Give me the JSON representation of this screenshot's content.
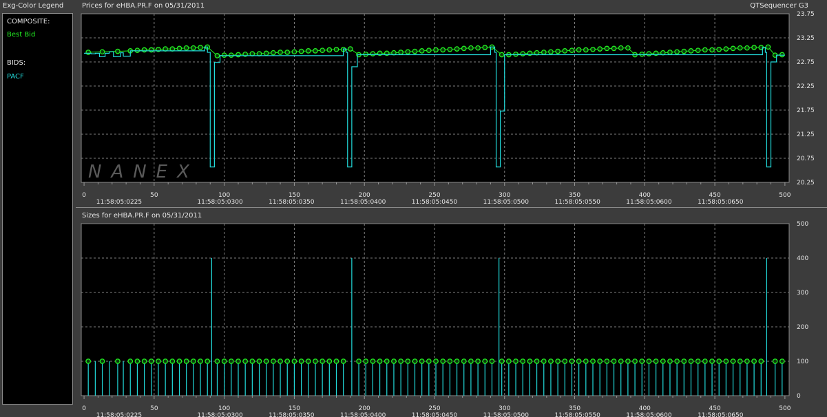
{
  "legend": {
    "title": "Exg-Color Legend",
    "composite_label": "COMPOSITE:",
    "composite_item": "Best Bid",
    "bids_label": "BIDS:",
    "bids_item": "PACF"
  },
  "app_title": "QTSequencer G3",
  "watermark": "NANEX",
  "colors": {
    "best_bid": "#22ee22",
    "pacf": "#22dddd",
    "grid": "#808080",
    "plot_bg": "#000000",
    "frame": "#8a8a8a"
  },
  "chart_data": [
    {
      "type": "line",
      "title": "Prices for  eHBA.PR.F  on  05/31/2011",
      "x_ticks": [
        "0",
        "50",
        "100",
        "150",
        "200",
        "250",
        "300",
        "350",
        "400",
        "450",
        "500"
      ],
      "x_tick_values": [
        0,
        50,
        100,
        150,
        200,
        250,
        300,
        350,
        400,
        450,
        500
      ],
      "time_labels": [
        "11:58:05:0225",
        "11:58:05:0300",
        "11:58:05:0350",
        "11:58:05:0400",
        "11:58:05:0450",
        "11:58:05:0500",
        "11:58:05:0550",
        "11:58:05:0600",
        "11:58:05:0650"
      ],
      "time_label_x": [
        25,
        97,
        148,
        199,
        250,
        301,
        352,
        403,
        454
      ],
      "y_ticks": [
        "23.75",
        "23.25",
        "22.75",
        "22.25",
        "21.75",
        "21.25",
        "20.75",
        "20.25"
      ],
      "ylim": [
        20.25,
        23.75
      ],
      "xlim": [
        -2,
        503
      ],
      "grid": true,
      "series": [
        {
          "name": "Best Bid",
          "color": "#22ee22",
          "style": "marker-line",
          "x": [
            3,
            13,
            24,
            33,
            38,
            43,
            48,
            53,
            58,
            63,
            68,
            73,
            78,
            83,
            88,
            95,
            100,
            105,
            110,
            115,
            120,
            125,
            130,
            135,
            140,
            145,
            150,
            155,
            160,
            165,
            170,
            175,
            180,
            185,
            190,
            196,
            201,
            206,
            211,
            216,
            221,
            226,
            231,
            236,
            241,
            246,
            251,
            256,
            261,
            266,
            271,
            276,
            281,
            286,
            291,
            298,
            303,
            308,
            313,
            318,
            323,
            328,
            333,
            338,
            343,
            348,
            353,
            358,
            363,
            368,
            373,
            378,
            383,
            388,
            393,
            398,
            403,
            408,
            413,
            418,
            423,
            428,
            433,
            438,
            443,
            448,
            453,
            458,
            463,
            468,
            473,
            478,
            483,
            488,
            493,
            498
          ],
          "y": [
            22.95,
            22.96,
            22.97,
            22.98,
            22.99,
            23.0,
            23.0,
            23.01,
            23.02,
            23.02,
            23.03,
            23.04,
            23.04,
            23.05,
            23.06,
            22.88,
            22.89,
            22.89,
            22.9,
            22.91,
            22.92,
            22.92,
            22.93,
            22.94,
            22.95,
            22.95,
            22.96,
            22.97,
            22.98,
            22.98,
            22.99,
            23.0,
            23.01,
            23.01,
            23.02,
            22.9,
            22.91,
            22.92,
            22.93,
            22.93,
            22.94,
            22.95,
            22.96,
            22.97,
            22.98,
            22.99,
            23.0,
            23.0,
            23.01,
            23.02,
            23.03,
            23.04,
            23.04,
            23.05,
            23.06,
            22.9,
            22.9,
            22.91,
            22.92,
            22.93,
            22.94,
            22.95,
            22.96,
            22.97,
            22.98,
            22.99,
            23.0,
            23.0,
            23.01,
            23.02,
            23.03,
            23.03,
            23.04,
            23.04,
            22.9,
            22.91,
            22.92,
            22.93,
            22.94,
            22.95,
            22.96,
            22.97,
            22.98,
            22.99,
            23.0,
            23.0,
            23.01,
            23.02,
            23.03,
            23.04,
            23.04,
            23.05,
            23.05,
            23.06,
            22.89,
            22.9
          ]
        },
        {
          "name": "PACF",
          "color": "#22dddd",
          "style": "step",
          "x": [
            0,
            5,
            8,
            11,
            15,
            18,
            21,
            26,
            28,
            31,
            33,
            86,
            88,
            90,
            92,
            93,
            95,
            97,
            185,
            187,
            188,
            190,
            191,
            193,
            195,
            290,
            293,
            294,
            296,
            297,
            299,
            300,
            484,
            486,
            487,
            489,
            490,
            492,
            494,
            500
          ],
          "y": [
            22.93,
            22.92,
            22.93,
            22.86,
            22.93,
            22.96,
            22.86,
            22.94,
            22.87,
            22.87,
            22.98,
            23.06,
            22.95,
            20.57,
            20.57,
            22.74,
            22.74,
            22.88,
            23.02,
            22.95,
            20.57,
            20.57,
            22.65,
            22.65,
            22.9,
            23.06,
            22.95,
            20.57,
            20.57,
            21.73,
            21.73,
            22.9,
            23.05,
            22.95,
            20.57,
            20.57,
            22.75,
            22.75,
            22.89,
            22.89
          ]
        }
      ]
    },
    {
      "type": "bar",
      "title": "Sizes for  eHBA.PR.F  on  05/31/2011",
      "x_ticks": [
        "0",
        "50",
        "100",
        "150",
        "200",
        "250",
        "300",
        "350",
        "400",
        "450",
        "500"
      ],
      "x_tick_values": [
        0,
        50,
        100,
        150,
        200,
        250,
        300,
        350,
        400,
        450,
        500
      ],
      "time_labels": [
        "11:58:05:0225",
        "11:58:05:0300",
        "11:58:05:0350",
        "11:58:05:0400",
        "11:58:05:0450",
        "11:58:05:0500",
        "11:58:05:0550",
        "11:58:05:0600",
        "11:58:05:0650"
      ],
      "time_label_x": [
        25,
        97,
        148,
        199,
        250,
        301,
        352,
        403,
        454
      ],
      "y_ticks": [
        "500",
        "400",
        "300",
        "200",
        "100",
        "0"
      ],
      "ylim": [
        0,
        500
      ],
      "xlim": [
        -2,
        503
      ],
      "grid": true,
      "series": [
        {
          "name": "PACF",
          "color": "#22dddd",
          "style": "spikes",
          "x": [
            3,
            8,
            13,
            18,
            24,
            28,
            33,
            38,
            43,
            48,
            53,
            58,
            63,
            68,
            73,
            78,
            83,
            88,
            91,
            95,
            100,
            105,
            110,
            115,
            120,
            125,
            130,
            135,
            140,
            145,
            150,
            155,
            160,
            165,
            170,
            175,
            180,
            185,
            191,
            196,
            201,
            206,
            211,
            216,
            221,
            226,
            231,
            236,
            241,
            246,
            251,
            256,
            261,
            266,
            271,
            276,
            281,
            286,
            291,
            296,
            298,
            303,
            308,
            313,
            318,
            323,
            328,
            333,
            338,
            343,
            348,
            353,
            358,
            363,
            368,
            373,
            378,
            383,
            388,
            393,
            398,
            403,
            408,
            413,
            418,
            423,
            428,
            433,
            438,
            443,
            448,
            453,
            458,
            463,
            468,
            473,
            478,
            483,
            487,
            493,
            498
          ],
          "y": [
            100,
            100,
            100,
            100,
            100,
            100,
            100,
            100,
            100,
            100,
            100,
            100,
            100,
            100,
            100,
            100,
            100,
            100,
            400,
            100,
            100,
            100,
            100,
            100,
            100,
            100,
            100,
            100,
            100,
            100,
            100,
            100,
            100,
            100,
            100,
            100,
            100,
            100,
            400,
            100,
            100,
            100,
            100,
            100,
            100,
            100,
            100,
            100,
            100,
            100,
            100,
            100,
            100,
            100,
            100,
            100,
            100,
            100,
            100,
            400,
            100,
            100,
            100,
            100,
            100,
            100,
            100,
            100,
            100,
            100,
            100,
            100,
            100,
            100,
            100,
            100,
            100,
            100,
            100,
            100,
            100,
            100,
            100,
            100,
            100,
            100,
            100,
            100,
            100,
            100,
            100,
            100,
            100,
            100,
            100,
            100,
            100,
            100,
            400,
            100,
            100
          ]
        },
        {
          "name": "Best Bid",
          "color": "#22ee22",
          "style": "markers",
          "x": [
            3,
            13,
            24,
            33,
            38,
            43,
            48,
            53,
            58,
            63,
            68,
            73,
            78,
            83,
            88,
            95,
            100,
            105,
            110,
            115,
            120,
            125,
            130,
            135,
            140,
            145,
            150,
            155,
            160,
            165,
            170,
            175,
            180,
            185,
            196,
            201,
            206,
            211,
            216,
            221,
            226,
            231,
            236,
            241,
            246,
            251,
            256,
            261,
            266,
            271,
            276,
            281,
            286,
            291,
            298,
            303,
            308,
            313,
            318,
            323,
            328,
            333,
            338,
            343,
            348,
            353,
            358,
            363,
            368,
            373,
            378,
            383,
            388,
            393,
            398,
            403,
            408,
            413,
            418,
            423,
            428,
            433,
            438,
            443,
            448,
            453,
            458,
            463,
            468,
            473,
            478,
            483,
            493,
            498
          ],
          "y": [
            100,
            100,
            100,
            100,
            100,
            100,
            100,
            100,
            100,
            100,
            100,
            100,
            100,
            100,
            100,
            100,
            100,
            100,
            100,
            100,
            100,
            100,
            100,
            100,
            100,
            100,
            100,
            100,
            100,
            100,
            100,
            100,
            100,
            100,
            100,
            100,
            100,
            100,
            100,
            100,
            100,
            100,
            100,
            100,
            100,
            100,
            100,
            100,
            100,
            100,
            100,
            100,
            100,
            100,
            100,
            100,
            100,
            100,
            100,
            100,
            100,
            100,
            100,
            100,
            100,
            100,
            100,
            100,
            100,
            100,
            100,
            100,
            100,
            100,
            100,
            100,
            100,
            100,
            100,
            100,
            100,
            100,
            100,
            100,
            100,
            100,
            100,
            100,
            100,
            100,
            100,
            100,
            100,
            100
          ]
        }
      ]
    }
  ]
}
